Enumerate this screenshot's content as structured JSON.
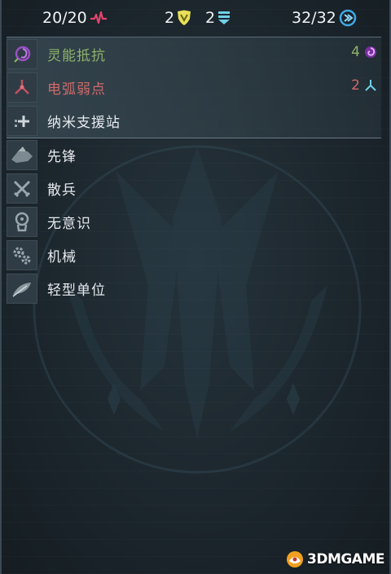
{
  "stats": {
    "health": "20/20",
    "armor": "2",
    "shield": "2",
    "action": "32/32"
  },
  "traits": [
    {
      "label": "灵能抵抗",
      "value": "4",
      "color": "#8fb26a"
    },
    {
      "label": "电弧弱点",
      "value": "2",
      "color": "#d06a6a"
    },
    {
      "label": "纳米支援站",
      "value": "",
      "color": "#e6eaee"
    },
    {
      "label": "先锋",
      "value": "",
      "color": "#e6eaee"
    },
    {
      "label": "散兵",
      "value": "",
      "color": "#e6eaee"
    },
    {
      "label": "无意识",
      "value": "",
      "color": "#e6eaee"
    },
    {
      "label": "机械",
      "value": "",
      "color": "#e6eaee"
    },
    {
      "label": "轻型单位",
      "value": "",
      "color": "#e6eaee"
    }
  ],
  "watermark": "3DMGAME"
}
